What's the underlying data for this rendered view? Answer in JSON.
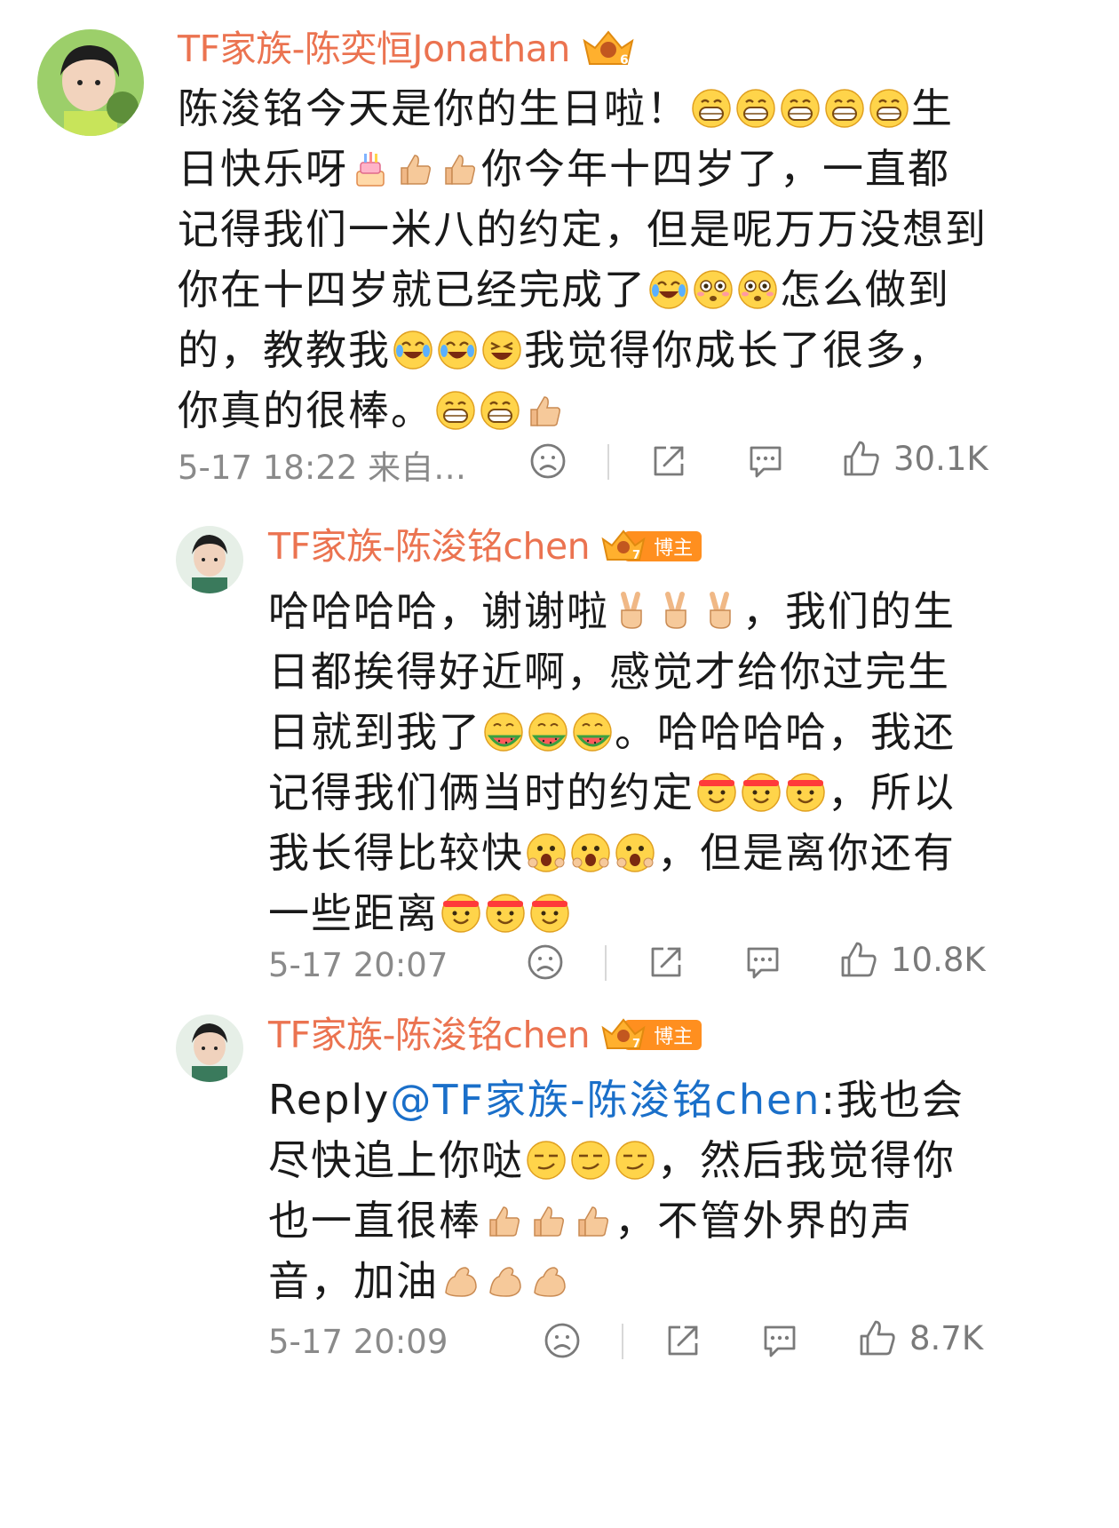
{
  "comments": [
    {
      "username": "TF家族-陈奕恒Jonathan",
      "level_badge": "6",
      "parts": [
        {
          "t": "text",
          "v": "陈浚铭今天是你的生日啦！"
        },
        {
          "t": "emoji",
          "icon": "grin-face-icon"
        },
        {
          "t": "emoji",
          "icon": "grin-face-icon"
        },
        {
          "t": "emoji",
          "icon": "grin-face-icon"
        },
        {
          "t": "emoji",
          "icon": "grin-face-icon"
        },
        {
          "t": "emoji",
          "icon": "grin-face-icon"
        },
        {
          "t": "text",
          "v": "生日快乐呀"
        },
        {
          "t": "emoji",
          "icon": "birthday-cake-icon"
        },
        {
          "t": "emoji",
          "icon": "thumbs-up-icon"
        },
        {
          "t": "emoji",
          "icon": "thumbs-up-icon"
        },
        {
          "t": "text",
          "v": "你今年十四岁了，一直都记得我们一米八的约定，但是呢万万没想到你在十四岁就已经完成了"
        },
        {
          "t": "emoji",
          "icon": "tears-of-joy-icon"
        },
        {
          "t": "emoji",
          "icon": "flushed-face-icon"
        },
        {
          "t": "emoji",
          "icon": "flushed-face-icon"
        },
        {
          "t": "text",
          "v": "怎么做到的，教教我"
        },
        {
          "t": "emoji",
          "icon": "tears-of-joy-icon"
        },
        {
          "t": "emoji",
          "icon": "tears-of-joy-icon"
        },
        {
          "t": "emoji",
          "icon": "laughing-face-icon"
        },
        {
          "t": "text",
          "v": "我觉得你成长了很多，你真的很棒。"
        },
        {
          "t": "emoji",
          "icon": "grin-face-icon"
        },
        {
          "t": "emoji",
          "icon": "grin-face-icon"
        },
        {
          "t": "emoji",
          "icon": "thumbs-up-icon"
        }
      ],
      "time": "5-17 18:22 来自…",
      "likes": "30.1K"
    },
    {
      "username": "TF家族-陈浚铭chen",
      "level_badge": "7",
      "role_badge": "博主",
      "parts": [
        {
          "t": "text",
          "v": "哈哈哈哈，谢谢啦"
        },
        {
          "t": "emoji",
          "icon": "victory-hand-icon"
        },
        {
          "t": "emoji",
          "icon": "victory-hand-icon"
        },
        {
          "t": "emoji",
          "icon": "victory-hand-icon"
        },
        {
          "t": "text",
          "v": "，我们的生日都挨得好近啊，感觉才给你过完生日就到我了"
        },
        {
          "t": "emoji",
          "icon": "eating-watermelon-icon"
        },
        {
          "t": "emoji",
          "icon": "eating-watermelon-icon"
        },
        {
          "t": "emoji",
          "icon": "eating-watermelon-icon"
        },
        {
          "t": "text",
          "v": "。哈哈哈哈，我还记得我们俩当时的约定"
        },
        {
          "t": "emoji",
          "icon": "headband-cheer-icon"
        },
        {
          "t": "emoji",
          "icon": "headband-cheer-icon"
        },
        {
          "t": "emoji",
          "icon": "headband-cheer-icon"
        },
        {
          "t": "text",
          "v": "，所以我长得比较快"
        },
        {
          "t": "emoji",
          "icon": "shocked-face-icon"
        },
        {
          "t": "emoji",
          "icon": "shocked-face-icon"
        },
        {
          "t": "emoji",
          "icon": "shocked-face-icon"
        },
        {
          "t": "text",
          "v": "，但是离你还有一些距离"
        },
        {
          "t": "emoji",
          "icon": "headband-cheer-icon"
        },
        {
          "t": "emoji",
          "icon": "headband-cheer-icon"
        },
        {
          "t": "emoji",
          "icon": "headband-cheer-icon"
        }
      ],
      "time": "5-17 20:07",
      "likes": "10.8K"
    },
    {
      "username": "TF家族-陈浚铭chen",
      "level_badge": "7",
      "role_badge": "博主",
      "parts": [
        {
          "t": "text",
          "v": "Reply"
        },
        {
          "t": "mention",
          "v": "@TF家族-陈浚铭chen"
        },
        {
          "t": "text",
          "v": ":我也会尽快追上你哒"
        },
        {
          "t": "emoji",
          "icon": "smug-face-icon"
        },
        {
          "t": "emoji",
          "icon": "smug-face-icon"
        },
        {
          "t": "emoji",
          "icon": "smug-face-icon"
        },
        {
          "t": "text",
          "v": "，然后我觉得你也一直很棒"
        },
        {
          "t": "emoji",
          "icon": "thumbs-up-icon"
        },
        {
          "t": "emoji",
          "icon": "thumbs-up-icon"
        },
        {
          "t": "emoji",
          "icon": "thumbs-up-icon"
        },
        {
          "t": "text",
          "v": "，不管外界的声音，加油"
        },
        {
          "t": "emoji",
          "icon": "flexed-biceps-icon"
        },
        {
          "t": "emoji",
          "icon": "flexed-biceps-icon"
        },
        {
          "t": "emoji",
          "icon": "flexed-biceps-icon"
        }
      ],
      "time": "5-17 20:09",
      "likes": "8.7K"
    }
  ],
  "colors": {
    "username": "#eb7350",
    "mention": "#1a6fc9",
    "meta": "#8a8a8a",
    "blogger_badge": "#ff8f1f"
  }
}
